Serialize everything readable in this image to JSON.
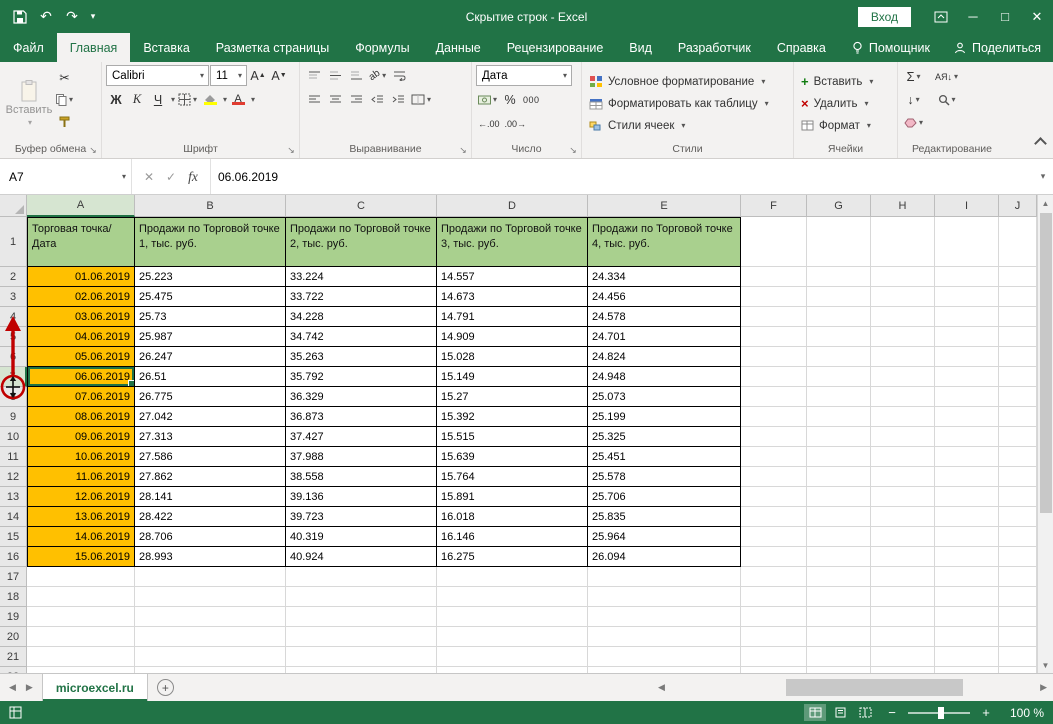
{
  "title_bar": {
    "app_title": "Скрытие строк - Excel",
    "sign_in": "Вход"
  },
  "ribbon": {
    "tabs": [
      "Файл",
      "Главная",
      "Вставка",
      "Разметка страницы",
      "Формулы",
      "Данные",
      "Рецензирование",
      "Вид",
      "Разработчик",
      "Справка"
    ],
    "active_tab": "Главная",
    "assistant": "Помощник",
    "share": "Поделиться",
    "clipboard": {
      "label": "Буфер обмена",
      "paste": "Вставить"
    },
    "font": {
      "label": "Шрифт",
      "name": "Calibri",
      "size": "11",
      "bold": "Ж",
      "italic": "К",
      "underline": "Ч"
    },
    "alignment": {
      "label": "Выравнивание"
    },
    "number": {
      "label": "Число",
      "format": "Дата",
      "percent": "%",
      "thousands": "000"
    },
    "styles": {
      "label": "Стили",
      "items": [
        "Условное форматирование",
        "Форматировать как таблицу",
        "Стили ячеек"
      ]
    },
    "cells": {
      "label": "Ячейки",
      "items": [
        "Вставить",
        "Удалить",
        "Формат"
      ]
    },
    "editing": {
      "label": "Редактирование",
      "autosum": "Σ"
    }
  },
  "formula_bar": {
    "name_box": "A7",
    "fx_label": "fx",
    "value": "06.06.2019"
  },
  "sheet": {
    "col_letters": [
      "A",
      "B",
      "C",
      "D",
      "E",
      "F",
      "G",
      "H",
      "I",
      "J"
    ],
    "visible_rows": 22,
    "selected_cell": "A7",
    "header_row": [
      "Торговая точка/\nДата",
      "Продажи по Торговой точке 1, тыс. руб.",
      "Продажи по Торговой точке 2, тыс. руб.",
      "Продажи по Торговой точке 3, тыс. руб.",
      "Продажи по Торговой точке 4, тыс. руб."
    ],
    "data_rows": [
      [
        "01.06.2019",
        "25.223",
        "33.224",
        "14.557",
        "24.334"
      ],
      [
        "02.06.2019",
        "25.475",
        "33.722",
        "14.673",
        "24.456"
      ],
      [
        "03.06.2019",
        "25.73",
        "34.228",
        "14.791",
        "24.578"
      ],
      [
        "04.06.2019",
        "25.987",
        "34.742",
        "14.909",
        "24.701"
      ],
      [
        "05.06.2019",
        "26.247",
        "35.263",
        "15.028",
        "24.824"
      ],
      [
        "06.06.2019",
        "26.51",
        "35.792",
        "15.149",
        "24.948"
      ],
      [
        "07.06.2019",
        "26.775",
        "36.329",
        "15.27",
        "25.073"
      ],
      [
        "08.06.2019",
        "27.042",
        "36.873",
        "15.392",
        "25.199"
      ],
      [
        "09.06.2019",
        "27.313",
        "37.427",
        "15.515",
        "25.325"
      ],
      [
        "10.06.2019",
        "27.586",
        "37.988",
        "15.639",
        "25.451"
      ],
      [
        "11.06.2019",
        "27.862",
        "38.558",
        "15.764",
        "25.578"
      ],
      [
        "12.06.2019",
        "28.141",
        "39.136",
        "15.891",
        "25.706"
      ],
      [
        "13.06.2019",
        "28.422",
        "39.723",
        "16.018",
        "25.835"
      ],
      [
        "14.06.2019",
        "28.706",
        "40.319",
        "16.146",
        "25.964"
      ],
      [
        "15.06.2019",
        "28.993",
        "40.924",
        "16.275",
        "26.094"
      ]
    ],
    "colors": {
      "header_fill": "#a9d08e",
      "date_fill": "#ffc000",
      "brand_green": "#217346",
      "annotation_red": "#c00000"
    }
  },
  "sheet_tabs": {
    "active": "microexcel.ru"
  },
  "status_bar": {
    "zoom": "100 %"
  }
}
